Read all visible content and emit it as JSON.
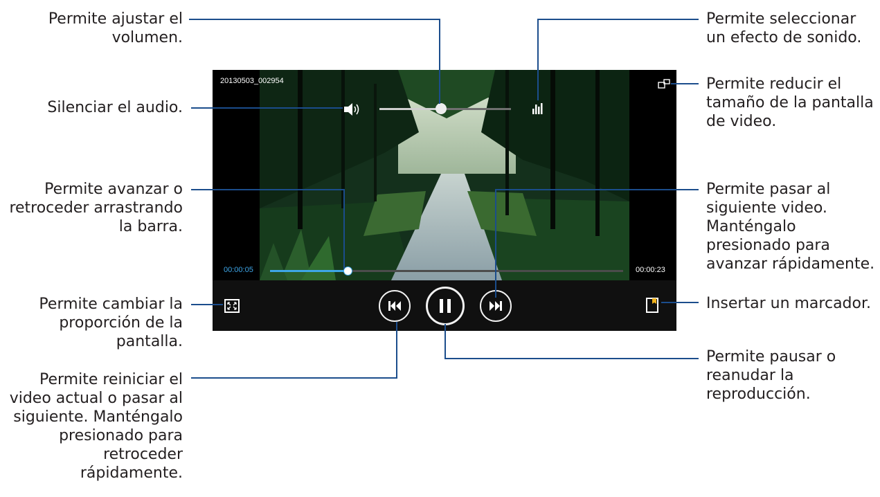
{
  "player": {
    "file_name": "20130503_002954",
    "time_elapsed": "00:00:05",
    "time_total": "00:00:23",
    "volume_fraction": 0.47,
    "seek_fraction": 0.22,
    "accent_color": "#3ea6e8",
    "icons": [
      "speaker-icon",
      "sound-effect-icon",
      "pop-up-player-icon",
      "aspect-ratio-icon",
      "previous-icon",
      "pause-icon",
      "next-icon",
      "bookmark-icon"
    ]
  },
  "callouts": {
    "volume": "Permite ajustar el\nvolumen.",
    "mute": "Silenciar el audio.",
    "seek": "Permite avanzar o\nretroceder arrastrando\nla barra.",
    "aspect_ratio": "Permite cambiar la\nproporción de la\npantalla.",
    "previous": "Permite reiniciar el\nvideo actual o pasar al\nsiguiente. Manténgalo\npresionado para\nretroceder\nrápidamente.",
    "sound_effect": "Permite seleccionar\nun efecto de sonido.",
    "pop_up": "Permite reducir el\ntamaño de la pantalla\nde video.",
    "next": "Permite pasar al\nsiguiente video.\nManténgalo\npresionado para\navanzar rápidamente.",
    "bookmark": "Insertar un marcador.",
    "pause": "Permite pausar o\nreanudar la\nreproducción."
  }
}
